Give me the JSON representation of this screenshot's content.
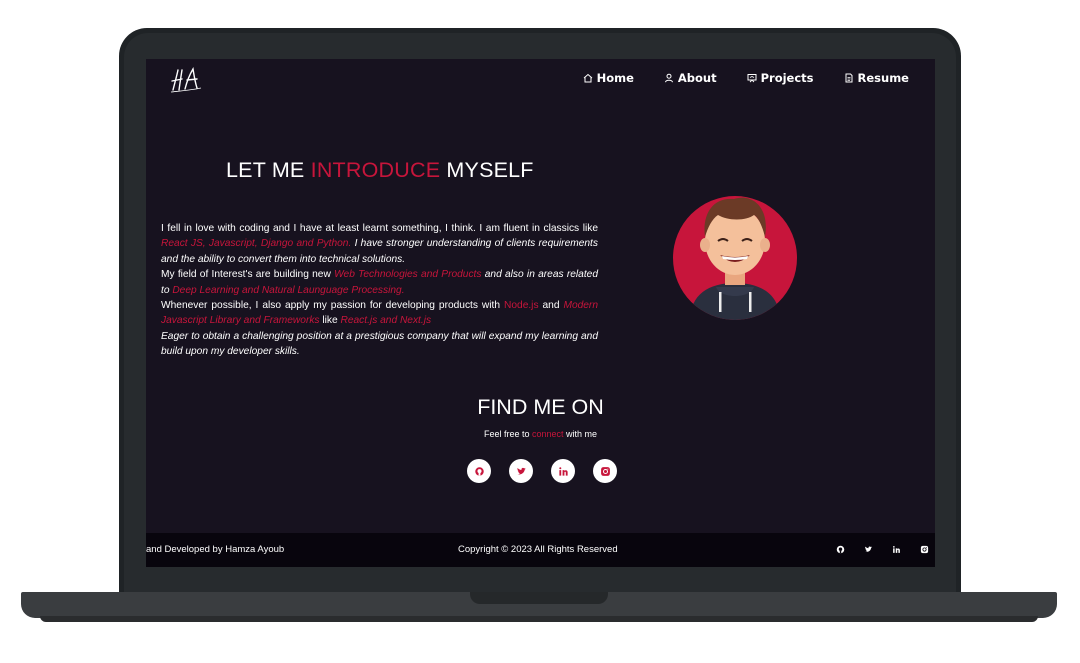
{
  "logo": {
    "text": "H.A"
  },
  "nav": {
    "items": [
      {
        "label": "Home",
        "icon": "home-icon"
      },
      {
        "label": "About",
        "icon": "user-icon"
      },
      {
        "label": "Projects",
        "icon": "projects-icon"
      },
      {
        "label": "Resume",
        "icon": "document-icon"
      }
    ]
  },
  "intro": {
    "title_pre": "LET ME ",
    "title_highlight": "INTRODUCE",
    "title_post": " MYSELF",
    "p1_a": "I fell in love with coding and I have at least learnt something, I think. I am fluent in classics like ",
    "p1_hl": "React JS, Javascript, Django and Python.",
    "p1_b": " I have stronger understanding of clients requirements and the ability to convert them into technical solutions.",
    "p2_a": "My field of Interest's are building new ",
    "p2_hl": " Web Technologies and Products",
    "p2_b": " and also in areas related to ",
    "p2_hl2": "Deep Learning and Natural Launguage Processing.",
    "p3_a": "Whenever possible, I also apply my passion for developing products with ",
    "p3_hl": "Node.js",
    "p3_b": " and ",
    "p3_hl2": "Modern Javascript Library and Frameworks",
    "p3_c": " like ",
    "p3_hl3": "React.js and Next.js",
    "p4": "Eager to obtain a challenging position at a prestigious company that will expand my learning and build upon my developer skills."
  },
  "find": {
    "title": "FIND ME ON",
    "sub_pre": "Feel free to ",
    "sub_hl": "connect",
    "sub_post": " with me"
  },
  "footer": {
    "left": "and Developed by Hamza Ayoub",
    "center": "Copyright © 2023 All Rights Reserved"
  },
  "colors": {
    "accent": "#c7153b",
    "background": "#17121f",
    "footer": "#08050d"
  }
}
